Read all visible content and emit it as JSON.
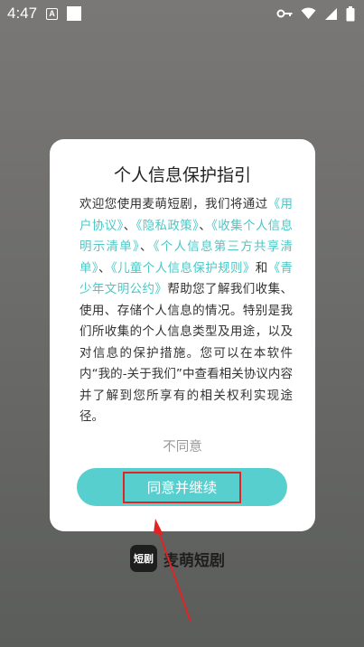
{
  "status_bar": {
    "time": "4:47",
    "notif_letter": "A",
    "icons": [
      "key-icon",
      "wifi-icon",
      "signal-icon",
      "battery-icon"
    ]
  },
  "dialog": {
    "title": "个人信息保护指引",
    "body": [
      {
        "text": "欢迎您使用麦萌短剧，我们将通过",
        "link": false
      },
      {
        "text": "《用户协议》",
        "link": true
      },
      {
        "text": "、",
        "link": false
      },
      {
        "text": "《隐私政策》",
        "link": true
      },
      {
        "text": "、",
        "link": false
      },
      {
        "text": "《收集个人信息明示清单》",
        "link": true
      },
      {
        "text": "、",
        "link": false
      },
      {
        "text": "《个人信息第三方共享清单》",
        "link": true
      },
      {
        "text": "、",
        "link": false
      },
      {
        "text": "《儿童个人信息保护规则》",
        "link": true
      },
      {
        "text": "和",
        "link": false
      },
      {
        "text": "《青少年文明公约》",
        "link": true
      },
      {
        "text": "帮助您了解我们收集、使用、存储个人信息的情况。特别是我们所收集的个人信息类型及用途，以及对信息的保护措施。您可以在本软件内“我的-关于我们”中查看相关协议内容并了解到您所享有的相关权利实现途径。",
        "link": false
      }
    ],
    "disagree_label": "不同意",
    "agree_label": "同意并继续"
  },
  "brand": {
    "logo_text": "短剧",
    "name": "麦萌短剧"
  },
  "colors": {
    "accent": "#58cfcf",
    "link": "#4cc7c6",
    "annotation": "#e02424"
  }
}
